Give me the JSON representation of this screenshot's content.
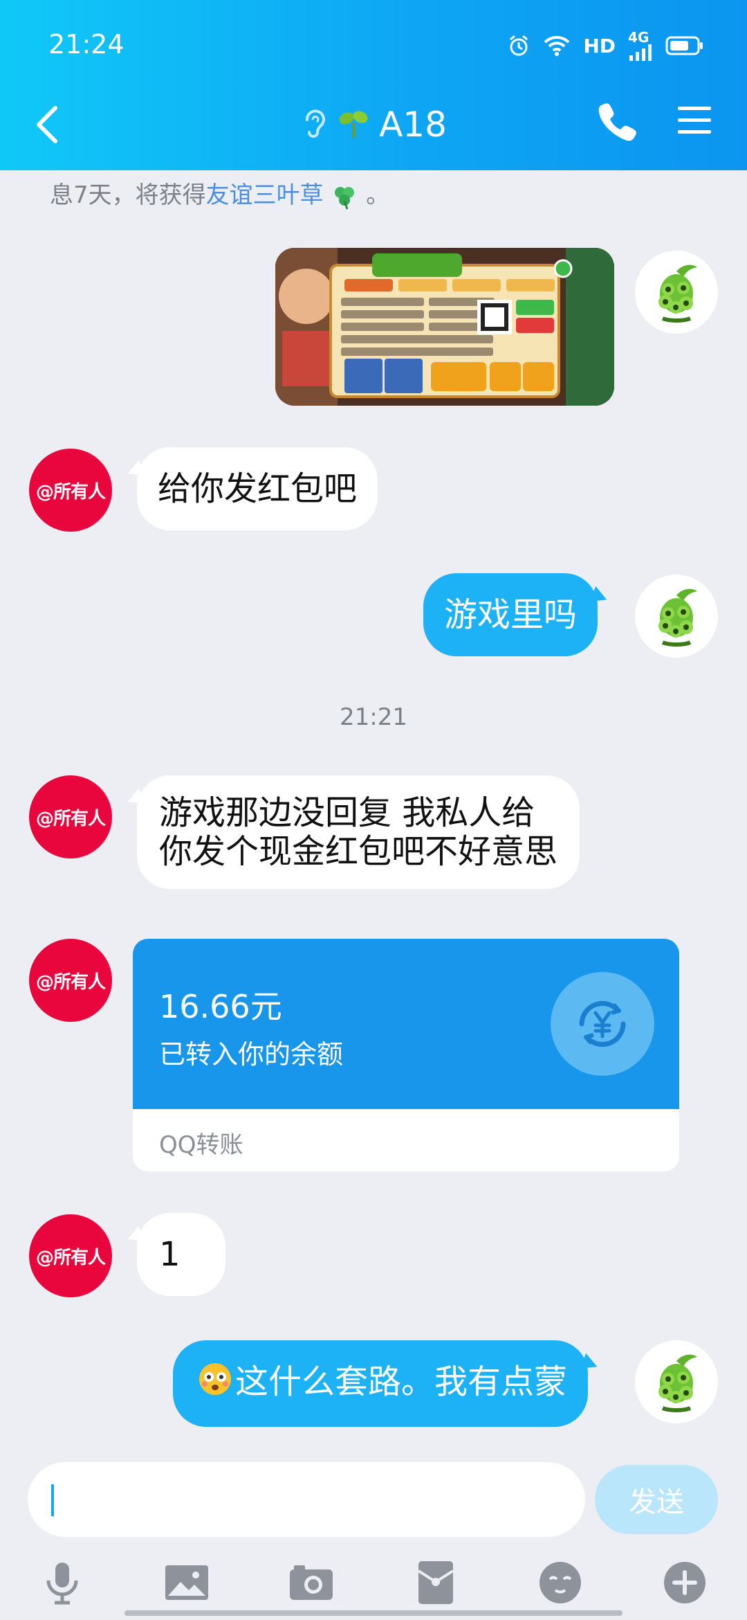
{
  "status_bar": {
    "time": "21:24",
    "hd_label": "HD",
    "network_label": "4G",
    "icons": [
      "alarm-icon",
      "wifi-icon",
      "signal-icon",
      "battery-icon"
    ]
  },
  "header": {
    "title": "A18",
    "icons": [
      "back-arrow-icon",
      "ear-icon",
      "sprout-icon",
      "phone-icon",
      "menu-icon"
    ]
  },
  "system_notice": {
    "prefix": "息7天，将获得",
    "highlight": "友谊三叶草",
    "suffix": "。"
  },
  "messages": {
    "msg_image": {
      "type": "image",
      "sender": "me",
      "description": "game promotion screenshot"
    },
    "msg1": {
      "sender": "other",
      "avatar_label": "@所有人",
      "text": "给你发红包吧"
    },
    "msg2": {
      "sender": "me",
      "text": "游戏里吗"
    },
    "time_divider": "21:21",
    "msg3": {
      "sender": "other",
      "avatar_label": "@所有人",
      "line1": "游戏那边没回复 我私人给",
      "line2": "你发个现金红包吧不好意思"
    },
    "transfer": {
      "sender": "other",
      "avatar_label": "@所有人",
      "amount": "16.66元",
      "status": "已转入你的余额",
      "label": "QQ转账"
    },
    "msg4": {
      "sender": "other",
      "avatar_label": "@所有人",
      "text": "1"
    },
    "msg5": {
      "sender": "me",
      "text": "这什么套路。我有点蒙"
    }
  },
  "input": {
    "value": "",
    "send_label": "发送"
  },
  "toolbar": {
    "items": [
      "microphone-icon",
      "image-icon",
      "camera-icon",
      "red-packet-icon",
      "emoji-icon",
      "plus-icon"
    ]
  },
  "colors": {
    "header_start": "#10c8f8",
    "header_end": "#0b95f0",
    "my_bubble": "#1db1f6",
    "transfer_card": "#1796ec",
    "avatar_red": "#e8063c"
  }
}
